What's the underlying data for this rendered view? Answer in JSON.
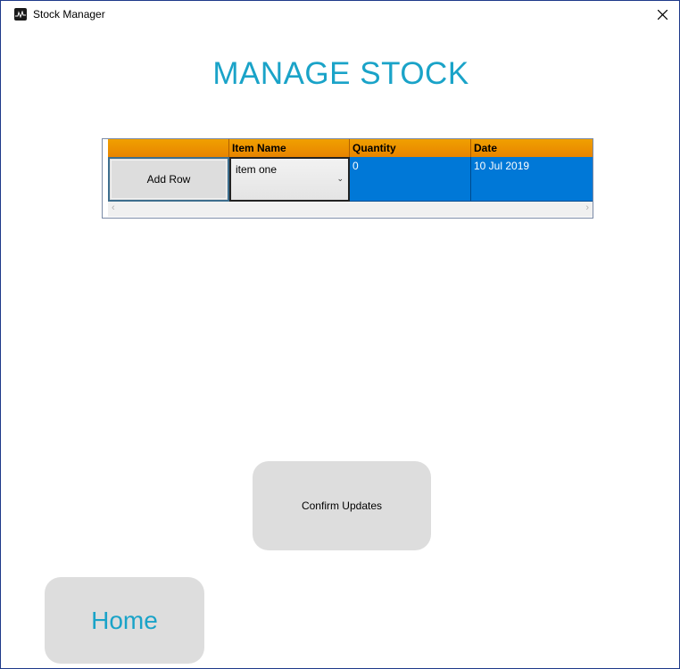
{
  "window": {
    "title": "Stock Manager"
  },
  "page": {
    "heading": "MANAGE STOCK"
  },
  "grid": {
    "columns": [
      "",
      "Item Name",
      "Quantity",
      "Date"
    ],
    "rows": [
      {
        "button_label": "Add Row",
        "item_name": "item one",
        "quantity": "0",
        "date": "10 Jul 2019"
      }
    ]
  },
  "buttons": {
    "confirm_label": "Confirm Updates",
    "home_label": "Home"
  },
  "icons": {
    "close": "close-icon",
    "app": "app-icon",
    "dropdown": "chevron-down-icon",
    "scroll_left": "chevron-left-icon",
    "scroll_right": "chevron-right-icon"
  },
  "colors": {
    "accent": "#1aa3c8",
    "header": "#e88400",
    "selection": "#0078d7",
    "button": "#dddddd"
  }
}
